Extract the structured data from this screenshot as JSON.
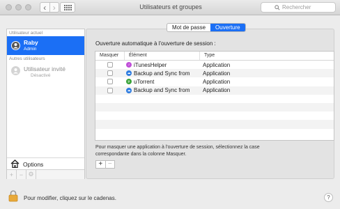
{
  "window": {
    "title": "Utilisateurs et groupes"
  },
  "search": {
    "placeholder": "Rechercher"
  },
  "sidebar": {
    "current_section": "Utilisateur actuel",
    "current_user": {
      "name": "Raby",
      "role": "Admin"
    },
    "other_section": "Autres utilisateurs",
    "guest_user": {
      "name": "Utilisateur invité",
      "role": "Désactivé"
    },
    "options_label": "Options",
    "footer": {
      "add": "+",
      "remove": "−",
      "action": "⚙"
    }
  },
  "tabs": [
    {
      "label": "Mot de passe",
      "active": false
    },
    {
      "label": "Ouverture",
      "active": true
    }
  ],
  "login_items": {
    "heading": "Ouverture automatique à l'ouverture de session :",
    "columns": {
      "mask": "Masquer",
      "element": "Élément",
      "type": "Type"
    },
    "rows": [
      {
        "name": "iTunesHelper",
        "type": "Application",
        "icon": "itunes-icon",
        "hidden": false
      },
      {
        "name": "Backup and Sync from",
        "type": "Application",
        "icon": "backup-sync-icon",
        "hidden": false
      },
      {
        "name": "uTorrent",
        "type": "Application",
        "icon": "utorrent-icon",
        "hidden": false
      },
      {
        "name": "Backup and Sync from",
        "type": "Application",
        "icon": "backup-sync-icon",
        "hidden": false
      }
    ],
    "hint": "Pour masquer une application à l'ouverture de session, sélectionnez la case correspondante dans la colonne Masquer.",
    "add": "+",
    "remove": "−"
  },
  "lock": {
    "label": "Pour modifier, cliquez sur le cadenas."
  },
  "help": {
    "label": "?"
  },
  "colors": {
    "accent": "#1b6ff5",
    "itunes": "#c04fd8",
    "utorrent": "#3aa33a",
    "backup_sync": "#2f7de1",
    "lock": "#e8a93a"
  }
}
